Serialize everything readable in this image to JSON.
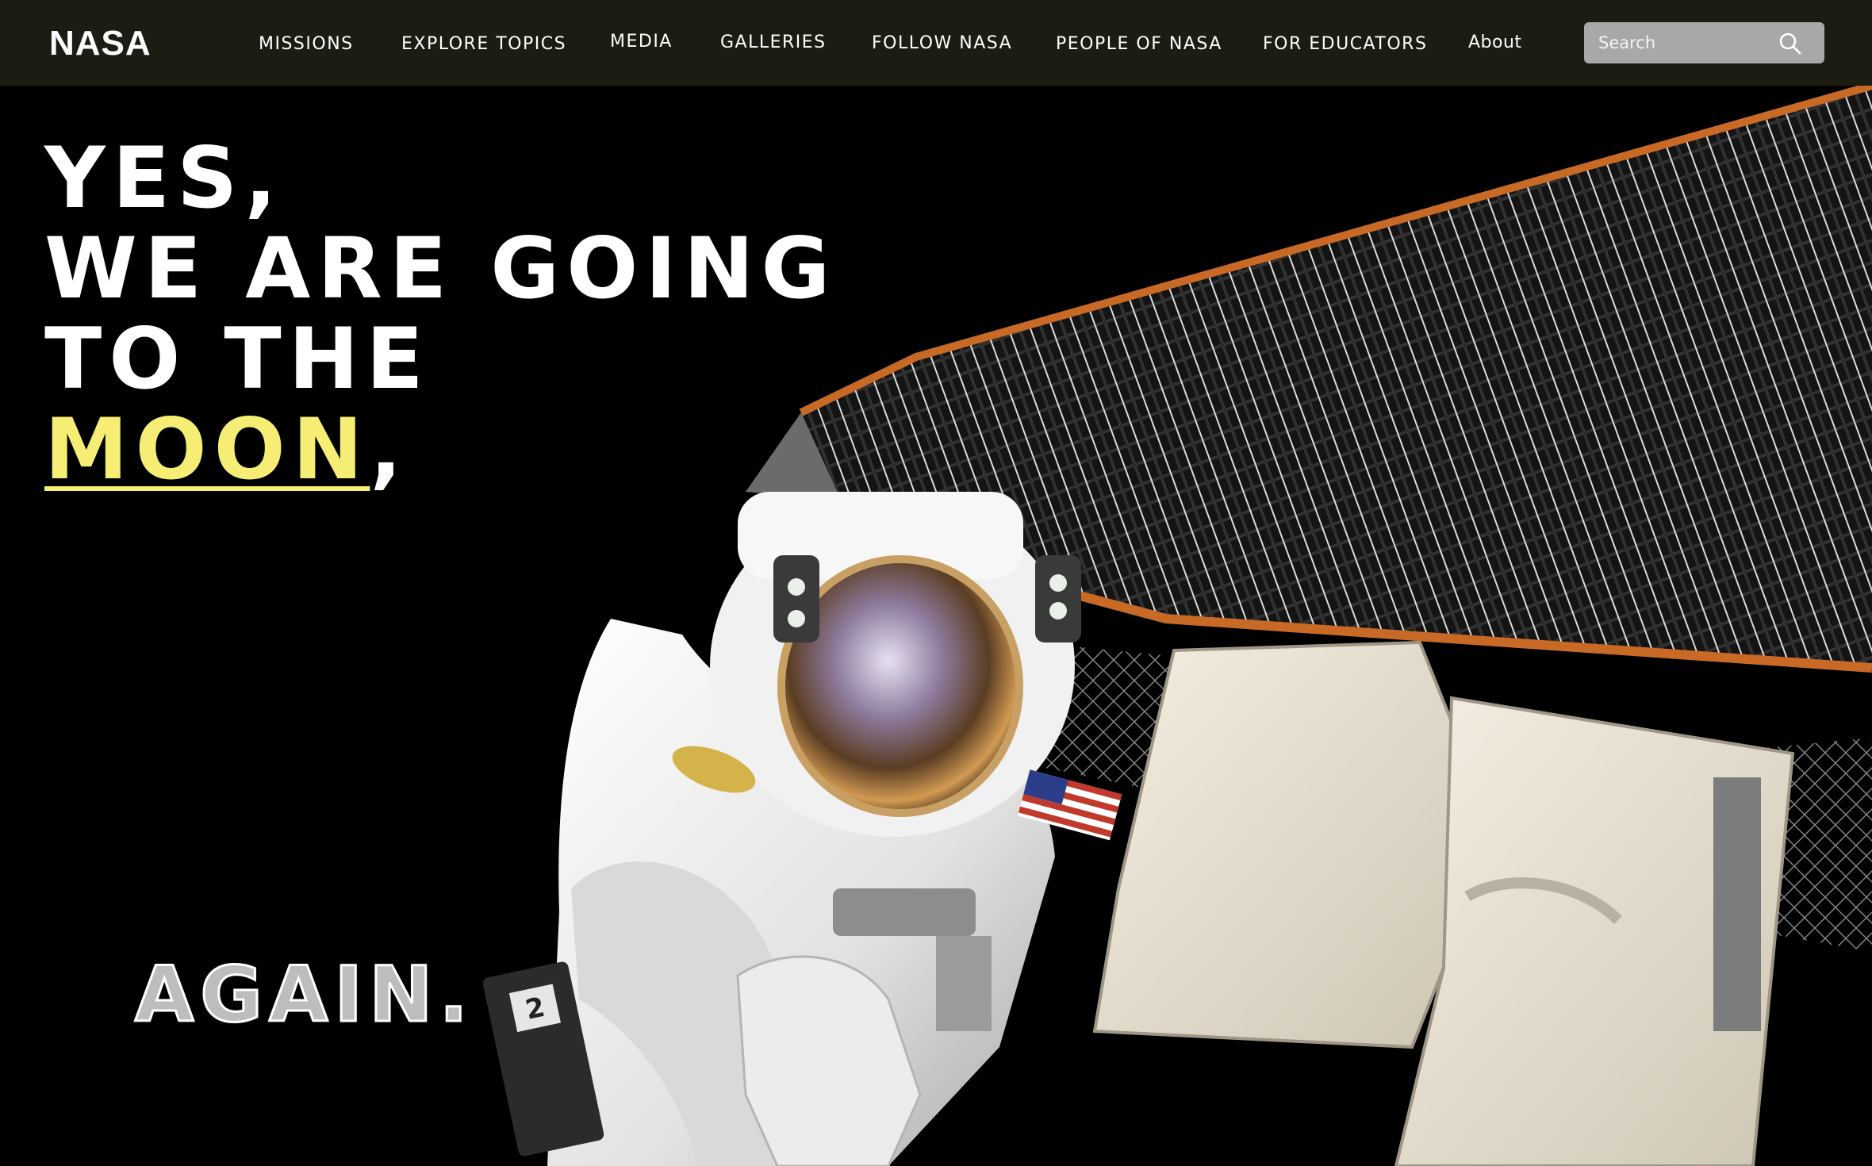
{
  "logo": "NASA",
  "nav": {
    "missions": "MISSIONS",
    "explore": "EXPLORE TOPICS",
    "media": "MEDIA",
    "galleries": "GALLERIES",
    "follow": "FOLLOW NASA",
    "people": "PEOPLE OF NASA",
    "educators": "FOR EDUCATORS",
    "about": "About"
  },
  "search": {
    "placeholder": "Search",
    "icon": "search-icon"
  },
  "hero": {
    "line1": "YES,",
    "line2": "WE ARE GOING",
    "line3": "TO THE",
    "highlight": "MOON",
    "comma": ",",
    "closing": "AGAIN.",
    "badge": "2"
  },
  "colors": {
    "nav_bg": "#1d1c12",
    "accent_yellow": "#f5ed74",
    "search_bg": "#a8a8a6",
    "background": "#000000"
  }
}
